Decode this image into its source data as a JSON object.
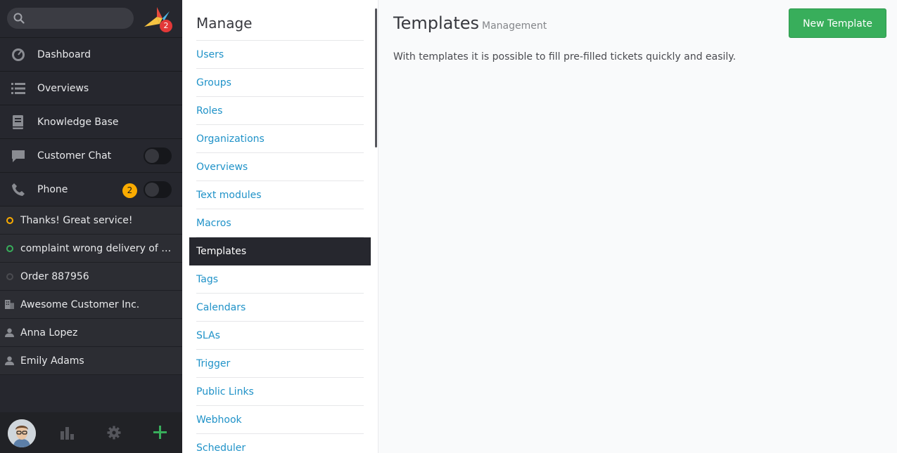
{
  "nav": {
    "search_placeholder": "",
    "notifications_count": "2",
    "items": [
      {
        "label": "Dashboard",
        "icon": "dashboard-icon"
      },
      {
        "label": "Overviews",
        "icon": "list-icon"
      },
      {
        "label": "Knowledge Base",
        "icon": "book-icon"
      },
      {
        "label": "Customer Chat",
        "icon": "chat-icon"
      },
      {
        "label": "Phone",
        "icon": "phone-icon",
        "badge": "2"
      }
    ],
    "tasks": [
      {
        "label": "Thanks! Great service!",
        "status_color": "#faab00"
      },
      {
        "label": "complaint wrong delivery of order",
        "status_color": "#38ae5b"
      },
      {
        "label": "Order 887956",
        "status_color": "#4a4b50"
      },
      {
        "label": "Awesome Customer Inc.",
        "icon": "organization-icon"
      },
      {
        "label": "Anna Lopez",
        "icon": "user-icon"
      },
      {
        "label": "Emily Adams",
        "icon": "user-icon"
      }
    ]
  },
  "manage": {
    "title": "Manage",
    "items": [
      "Users",
      "Groups",
      "Roles",
      "Organizations",
      "Overviews",
      "Text modules",
      "Macros",
      "Templates",
      "Tags",
      "Calendars",
      "SLAs",
      "Trigger",
      "Public Links",
      "Webhook",
      "Scheduler"
    ],
    "active": "Templates"
  },
  "content": {
    "title": "Templates",
    "subtitle": "Management",
    "description": "With templates it is possible to fill pre-filled tickets quickly and easily.",
    "new_button": "New Template"
  },
  "colors": {
    "accent_green": "#38ae5b",
    "link_blue": "#1f92c8",
    "nav_bg": "#26272e",
    "badge_yellow": "#faab00",
    "badge_red": "#e33838"
  }
}
